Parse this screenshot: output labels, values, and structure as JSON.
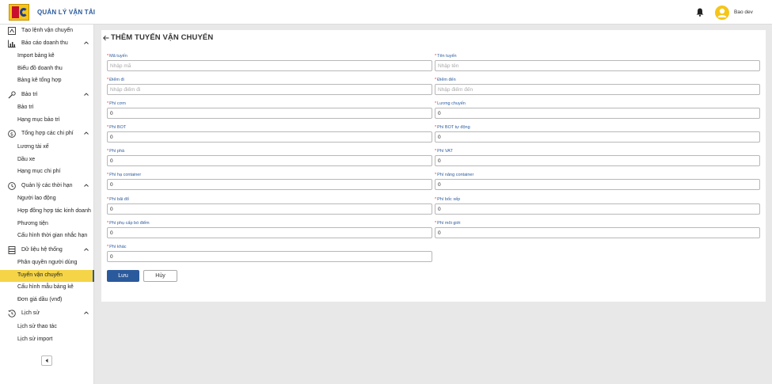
{
  "header": {
    "app_title": "QUẢN LÝ VẬN TẢI",
    "user_name": "Bao dev"
  },
  "sidebar": {
    "items": [
      {
        "label": "Tạo lệnh vận chuyển",
        "icon": "edit-icon"
      },
      {
        "label": "Báo cáo doanh thu",
        "icon": "chart-icon",
        "sub": [
          "Import bảng kê",
          "Biểu đồ doanh thu",
          "Bảng kê tổng hợp"
        ]
      },
      {
        "label": "Bảo trì",
        "icon": "wrench-icon",
        "sub": [
          "Bảo trì",
          "Hạng mục bảo trì"
        ]
      },
      {
        "label": "Tổng hợp các chi phí",
        "icon": "dollar-icon",
        "sub": [
          "Lương tài xế",
          "Dầu xe",
          "Hạng mục chi phí"
        ]
      },
      {
        "label": "Quản lý các thời hạn",
        "icon": "clock-icon",
        "sub": [
          "Người lao động",
          "Hợp đồng hợp tác kinh doanh",
          "Phương tiện",
          "Cấu hình thời gian nhắc hạn"
        ]
      },
      {
        "label": "Dữ liệu hệ thống",
        "icon": "database-icon",
        "sub": [
          "Phân quyền người dùng",
          "Tuyến vận chuyển",
          "Cấu hình mẫu bảng kê",
          "Đơn giá dầu (vnđ)"
        ]
      },
      {
        "label": "Lịch sử",
        "icon": "history-icon",
        "sub": [
          "Lịch sử thao tác",
          "Lịch sử import"
        ]
      }
    ],
    "active_item": "Tuyến vận chuyển"
  },
  "form": {
    "title": "THÊM TUYẾN VẬN CHUYỂN",
    "fields": [
      {
        "label": "Mã tuyến",
        "placeholder": "Nhập mã",
        "value": ""
      },
      {
        "label": "Tên tuyến",
        "placeholder": "Nhập tên",
        "value": ""
      },
      {
        "label": "Điểm đi",
        "placeholder": "Nhập điểm đi",
        "value": ""
      },
      {
        "label": "Điểm đến",
        "placeholder": "Nhập điểm đến",
        "value": ""
      },
      {
        "label": "Phí cơm",
        "placeholder": "",
        "value": "0"
      },
      {
        "label": "Lương chuyến",
        "placeholder": "",
        "value": "0"
      },
      {
        "label": "Phí BOT",
        "placeholder": "",
        "value": "0"
      },
      {
        "label": "Phí BOT tự động",
        "placeholder": "",
        "value": "0"
      },
      {
        "label": "Phí phà",
        "placeholder": "",
        "value": "0"
      },
      {
        "label": "Phí VAT",
        "placeholder": "",
        "value": "0"
      },
      {
        "label": "Phí hạ container",
        "placeholder": "",
        "value": "0"
      },
      {
        "label": "Phí nâng container",
        "placeholder": "",
        "value": "0"
      },
      {
        "label": "Phí bãi đổ",
        "placeholder": "",
        "value": "0"
      },
      {
        "label": "Phí bốc xếp",
        "placeholder": "",
        "value": "0"
      },
      {
        "label": "Phí phụ cấp bó điểm",
        "placeholder": "",
        "value": "0"
      },
      {
        "label": "Phí môi giới",
        "placeholder": "",
        "value": "0"
      },
      {
        "label": "Phí khác",
        "placeholder": "",
        "value": "0"
      }
    ],
    "save_label": "Lưu",
    "cancel_label": "Hủy"
  },
  "colors": {
    "accent": "#2b5a9c",
    "active_bg": "#f5d547",
    "required": "#e33333"
  }
}
